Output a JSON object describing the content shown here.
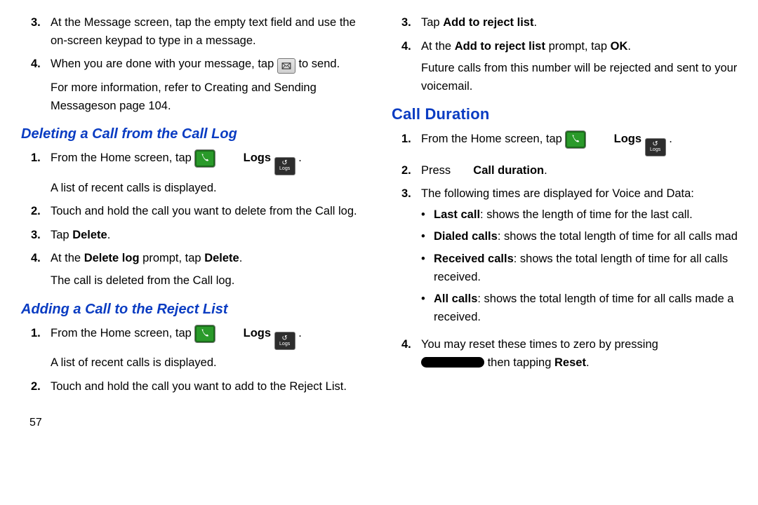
{
  "col1": {
    "top": {
      "items": [
        {
          "n": "3.",
          "text": "At the Message screen, tap the empty text field and use the on-screen keypad to type in a message."
        },
        {
          "n": "4.",
          "pre": "When you are done with your message, tap ",
          "post": " to send."
        }
      ],
      "footer_pre": "For more information, refer to ",
      "footer_link": " Creating and Sending Messages",
      "footer_post": "on page 104."
    },
    "sec_delete": {
      "title": "Deleting a Call from the Call Log",
      "items": [
        {
          "n": "1.",
          "pre": "From the Home screen, tap ",
          "logs": "Logs",
          "post": ".",
          "after": "A list of recent calls is displayed."
        },
        {
          "n": "2.",
          "text": "Touch and hold the call you want to delete from the Call log."
        },
        {
          "n": "3.",
          "pre": "Tap ",
          "b1": "Delete",
          "post": "."
        },
        {
          "n": "4.",
          "pre": "At the ",
          "b1": "Delete log",
          "mid": " prompt, tap ",
          "b2": "Delete",
          "post": ".",
          "after": "The call is deleted from the Call log."
        }
      ]
    },
    "sec_reject": {
      "title": "Adding a Call to the Reject List",
      "items": [
        {
          "n": "1.",
          "pre": "From the Home screen, tap ",
          "logs": "Logs",
          "post": ".",
          "after": "A list of recent calls is displayed."
        },
        {
          "n": "2.",
          "text": "Touch and hold the call you want to add to the Reject List."
        }
      ]
    },
    "pagenum": "57"
  },
  "col2": {
    "top": {
      "items": [
        {
          "n": "3.",
          "pre": "Tap ",
          "b1": "Add to reject list",
          "post": "."
        },
        {
          "n": "4.",
          "pre": "At the ",
          "b1": "Add to reject list",
          "mid": " prompt, tap ",
          "b2": "OK",
          "post": ".",
          "after": "Future calls from this number will be rejected and sent to your voicemail."
        }
      ]
    },
    "sec_duration": {
      "title": "Call Duration",
      "items1": [
        {
          "n": "1.",
          "pre": "From the Home screen, tap ",
          "logs": "Logs",
          "post": "."
        },
        {
          "n": "2.",
          "pre": "Press ",
          "gap": "      ",
          "b1": "Call duration",
          "post": "."
        },
        {
          "n": "3.",
          "text": "The following times are displayed for Voice and Data:"
        }
      ],
      "bullets": [
        {
          "b": "Last call",
          "text": ": shows the length of time for the last call."
        },
        {
          "b": "Dialed calls",
          "text": ": shows the total length of time for all calls mad"
        },
        {
          "b": "Received calls",
          "text": ": shows the total length of time for all calls received."
        },
        {
          "b": "All calls",
          "text": ": shows the total length of time for all calls made a received."
        }
      ],
      "items2": [
        {
          "n": "4.",
          "text_pre": "You may reset these times to zero by pressing",
          "text_post": " then tapping ",
          "b1": "Reset",
          "post": "."
        }
      ]
    }
  },
  "icons": {
    "logs_label": "Logs"
  }
}
